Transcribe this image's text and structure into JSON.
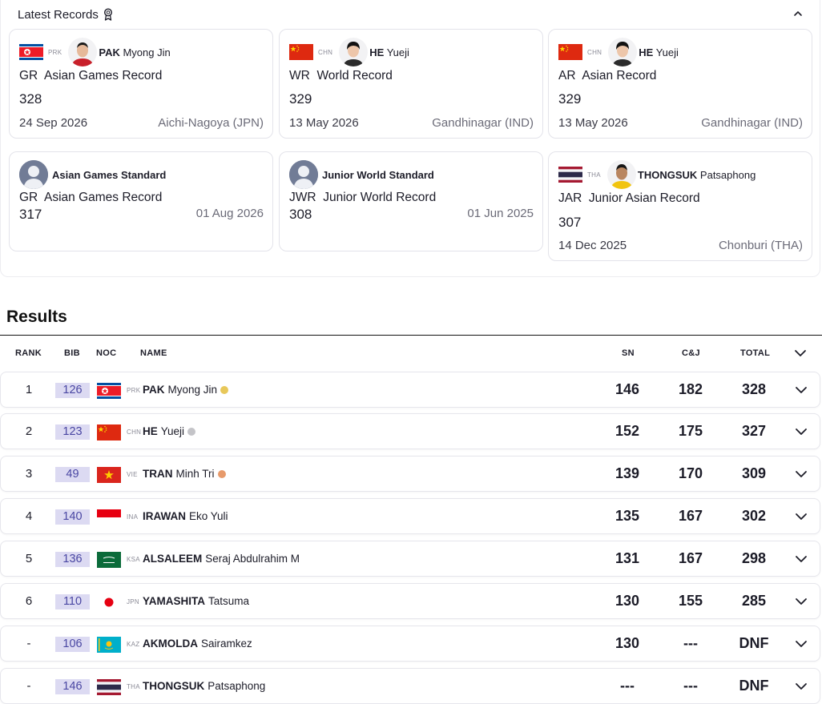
{
  "records": {
    "title": "Latest Records",
    "cards": [
      {
        "noc": "PRK",
        "name_last": "PAK",
        "name_first": "Myong Jin",
        "code": "GR",
        "record": "Asian Games Record",
        "value": "328",
        "date": "24 Sep 2026",
        "place": "Aichi-Nagoya (JPN)"
      },
      {
        "noc": "CHN",
        "name_last": "HE",
        "name_first": "Yueji",
        "code": "WR",
        "record": "World Record",
        "value": "329",
        "date": "13 May 2026",
        "place": "Gandhinagar (IND)"
      },
      {
        "noc": "CHN",
        "name_last": "HE",
        "name_first": "Yueji",
        "code": "AR",
        "record": "Asian Record",
        "value": "329",
        "date": "13 May 2026",
        "place": "Gandhinagar (IND)"
      },
      {
        "standard": "Asian Games Standard",
        "code": "GR",
        "record": "Asian Games Record",
        "value": "317",
        "date": "01 Aug 2026"
      },
      {
        "standard": "Junior World Standard",
        "code": "JWR",
        "record": "Junior World Record",
        "value": "308",
        "date": "01 Jun 2025"
      },
      {
        "noc": "THA",
        "name_last": "THONGSUK",
        "name_first": "Patsaphong",
        "code": "JAR",
        "record": "Junior Asian Record",
        "value": "307",
        "date": "14 Dec 2025",
        "place": "Chonburi (THA)"
      }
    ]
  },
  "results": {
    "title": "Results",
    "headers": {
      "rank": "RANK",
      "bib": "BIB",
      "noc": "NOC",
      "name": "NAME",
      "sn": "SN",
      "cj": "C&J",
      "total": "TOTAL"
    },
    "rows": [
      {
        "rank": "1",
        "bib": "126",
        "noc": "PRK",
        "last": "PAK",
        "first": "Myong Jin",
        "medal": "gold",
        "sn": "146",
        "cj": "182",
        "total": "328"
      },
      {
        "rank": "2",
        "bib": "123",
        "noc": "CHN",
        "last": "HE",
        "first": "Yueji",
        "medal": "silver",
        "sn": "152",
        "cj": "175",
        "total": "327"
      },
      {
        "rank": "3",
        "bib": "49",
        "noc": "VIE",
        "last": "TRAN",
        "first": "Minh Tri",
        "medal": "bronze",
        "sn": "139",
        "cj": "170",
        "total": "309"
      },
      {
        "rank": "4",
        "bib": "140",
        "noc": "INA",
        "last": "IRAWAN",
        "first": "Eko Yuli",
        "sn": "135",
        "cj": "167",
        "total": "302"
      },
      {
        "rank": "5",
        "bib": "136",
        "noc": "KSA",
        "last": "ALSALEEM",
        "first": "Seraj Abdulrahim M",
        "sn": "131",
        "cj": "167",
        "total": "298"
      },
      {
        "rank": "6",
        "bib": "110",
        "noc": "JPN",
        "last": "YAMASHITA",
        "first": "Tatsuma",
        "sn": "130",
        "cj": "155",
        "total": "285"
      },
      {
        "rank": "-",
        "bib": "106",
        "noc": "KAZ",
        "last": "AKMOLDA",
        "first": "Sairamkez",
        "sn": "130",
        "cj": "---",
        "total": "DNF"
      },
      {
        "rank": "-",
        "bib": "146",
        "noc": "THA",
        "last": "THONGSUK",
        "first": "Patsaphong",
        "sn": "---",
        "cj": "---",
        "total": "DNF"
      }
    ]
  },
  "colors": {
    "bib_bg": "#dcdaf2",
    "bib_text": "#4a47a3",
    "gold": "#e8c85a",
    "silver": "#c4c4c8",
    "bronze": "#e79a6b"
  },
  "icons": {
    "title": "medal-icon",
    "collapse": "chevron-up-icon",
    "expand": "chevron-down-icon"
  }
}
